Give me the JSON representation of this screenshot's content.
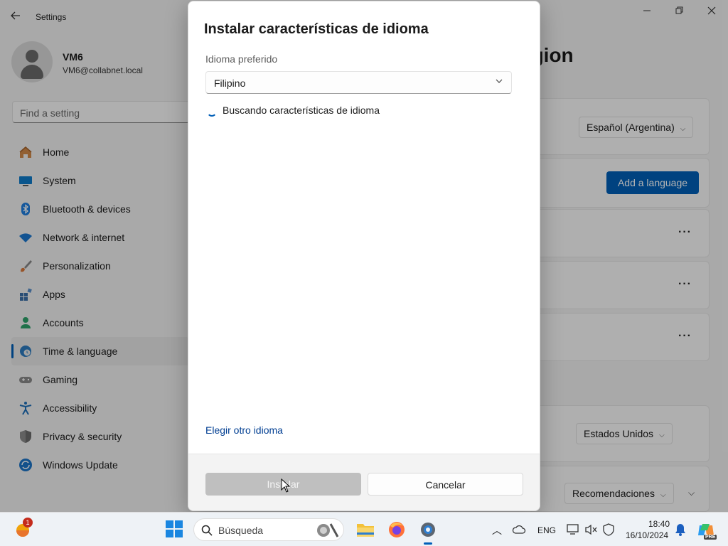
{
  "window": {
    "app_title": "Settings"
  },
  "profile": {
    "name": "VM6",
    "email": "VM6@collabnet.local"
  },
  "search": {
    "placeholder": "Find a setting"
  },
  "sidebar": {
    "items": [
      {
        "label": "Home",
        "icon": "home-icon"
      },
      {
        "label": "System",
        "icon": "system-icon"
      },
      {
        "label": "Bluetooth & devices",
        "icon": "bluetooth-icon"
      },
      {
        "label": "Network & internet",
        "icon": "wifi-icon"
      },
      {
        "label": "Personalization",
        "icon": "brush-icon"
      },
      {
        "label": "Apps",
        "icon": "apps-icon"
      },
      {
        "label": "Accounts",
        "icon": "account-icon"
      },
      {
        "label": "Time & language",
        "icon": "clock-globe-icon",
        "active": true
      },
      {
        "label": "Gaming",
        "icon": "gamepad-icon"
      },
      {
        "label": "Accessibility",
        "icon": "accessibility-icon"
      },
      {
        "label": "Privacy & security",
        "icon": "shield-icon"
      },
      {
        "label": "Windows Update",
        "icon": "update-icon"
      }
    ]
  },
  "main": {
    "heading_fragment": "egion",
    "display_language": "Español (Argentina)",
    "add_language_label": "Add a language",
    "more_label": "···",
    "country": "Estados Unidos",
    "recommendations": "Recomendaciones"
  },
  "dialog": {
    "title": "Instalar características de idioma",
    "preferred_label": "Idioma preferido",
    "preferred_value": "Filipino",
    "status": "Buscando características de idioma",
    "other_link": "Elegir otro idioma",
    "install_label": "Instalar",
    "cancel_label": "Cancelar"
  },
  "taskbar": {
    "notification_count": "1",
    "search_label": "Búsqueda",
    "lang": "ENG",
    "time": "18:40",
    "date": "16/10/2024",
    "copilot_badge": "PRE"
  },
  "colors": {
    "accent": "#005fb8",
    "link": "#003e92"
  }
}
